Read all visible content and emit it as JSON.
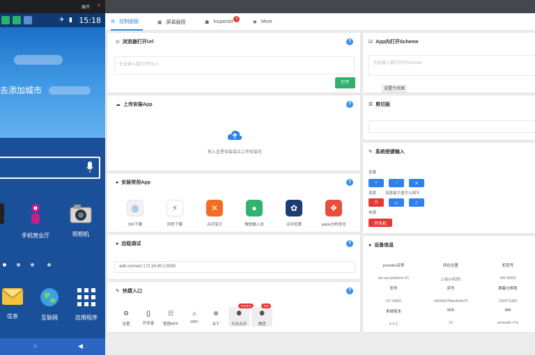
{
  "phone": {
    "top_label": "展开",
    "close": "✕",
    "status_time": "15:18",
    "status_icons": "✈ ▮",
    "weather_city": "去添加城市",
    "apps": [
      {
        "label": "手机营业厅",
        "icon": "person-icon"
      },
      {
        "label": "照相机",
        "icon": "camera-icon"
      }
    ],
    "dock": [
      {
        "label": "信息",
        "icon": "mail-icon"
      },
      {
        "label": "互联网",
        "icon": "globe-icon"
      },
      {
        "label": "应用程序",
        "icon": "grid-icon"
      }
    ],
    "nav": [
      "○",
      "◀"
    ]
  },
  "tabs": [
    {
      "label": "控制面板",
      "icon": "⚙"
    },
    {
      "label": "屏幕截图",
      "icon": "▣"
    },
    {
      "label": "Inspector",
      "icon": "☗",
      "badge": "2"
    },
    {
      "label": "More",
      "icon": "✱"
    }
  ],
  "cards": {
    "open_url": {
      "title": "浏览器打开Url",
      "icon": "⊙",
      "placeholder": "在此输入要打开的Url",
      "button": "打开"
    },
    "open_scheme": {
      "title": "App内打开Scheme",
      "icon": "☑",
      "placeholder": "在此输入要打开的Scheme",
      "button": "设置为页面"
    },
    "upload": {
      "title": "上传安装App",
      "icon": "☁",
      "hint": "拖入这里安装或点上传安装包"
    },
    "clipboard": {
      "title": "剪切板",
      "icon": "☰"
    },
    "installed": {
      "title": "安装常用App",
      "icon": "●",
      "apps": [
        {
          "label": "360下载",
          "color": "#f2f2f2",
          "fg": "#1f6fd1",
          "glyph": "◎"
        },
        {
          "label": "同时下载",
          "color": "#ffffff",
          "fg": "#2f80ed",
          "glyph": "⚡"
        },
        {
          "label": "点评宝贝",
          "color": "#f36c21",
          "fg": "#ffffff",
          "glyph": "✕"
        },
        {
          "label": "微信输入法",
          "color": "#30b36b",
          "fg": "#ffffff",
          "glyph": "●"
        },
        {
          "label": "点评优惠",
          "color": "#1c3d73",
          "fg": "#ffffff",
          "glyph": "✿"
        },
        {
          "label": "apple分析优化",
          "color": "#e94d3c",
          "fg": "#ffffff",
          "glyph": "❖"
        }
      ]
    },
    "keyboard": {
      "title": "系统按键输入",
      "icon": "✎",
      "row1_label": "音量",
      "row2_label": "亮度",
      "row2_hint": "亮度最大值可以调节",
      "row3_label": "电源",
      "row3_button": "开关机"
    },
    "remote": {
      "title": "远程调试",
      "icon": "●",
      "command": "adb connect 172.16.90.1:5555"
    },
    "device": {
      "title": "设备信息",
      "icon": "●",
      "cells": [
        {
          "k": "provider名称",
          "v": "dw-ad-platform-01"
        },
        {
          "k": "所在位置",
          "v": "上海(G机房)"
        },
        {
          "k": "机型号",
          "v": "SM-N900"
        },
        {
          "k": "型号",
          "v": "GT-N900"
        },
        {
          "k": "序号",
          "v": "4d00d578ba4d4d75"
        },
        {
          "k": "屏幕分辨率",
          "v": "1920*1080"
        },
        {
          "k": "系统版本",
          "v": "5.0.2"
        },
        {
          "k": "SDK",
          "v": "19"
        },
        {
          "k": "ABI",
          "v": "armeabi-v7a"
        }
      ]
    },
    "quick": {
      "title": "快捷入口",
      "icon": "✎",
      "items": [
        {
          "label": "设置",
          "icon": "⚙"
        },
        {
          "label": "开发者",
          "icon": "{}"
        },
        {
          "label": "管理APP",
          "icon": "☷"
        },
        {
          "label": "WIFI",
          "icon": "⌂"
        },
        {
          "label": "关于",
          "icon": "⊕"
        },
        {
          "label": "大众点评",
          "icon": "⚉",
          "badge": "8.8.8.8"
        },
        {
          "label": "美团",
          "icon": "⚉",
          "badge": "8.8"
        }
      ]
    }
  },
  "colors": {
    "accent": "#2f80ed",
    "green": "#32b06e",
    "red": "#e53935"
  }
}
